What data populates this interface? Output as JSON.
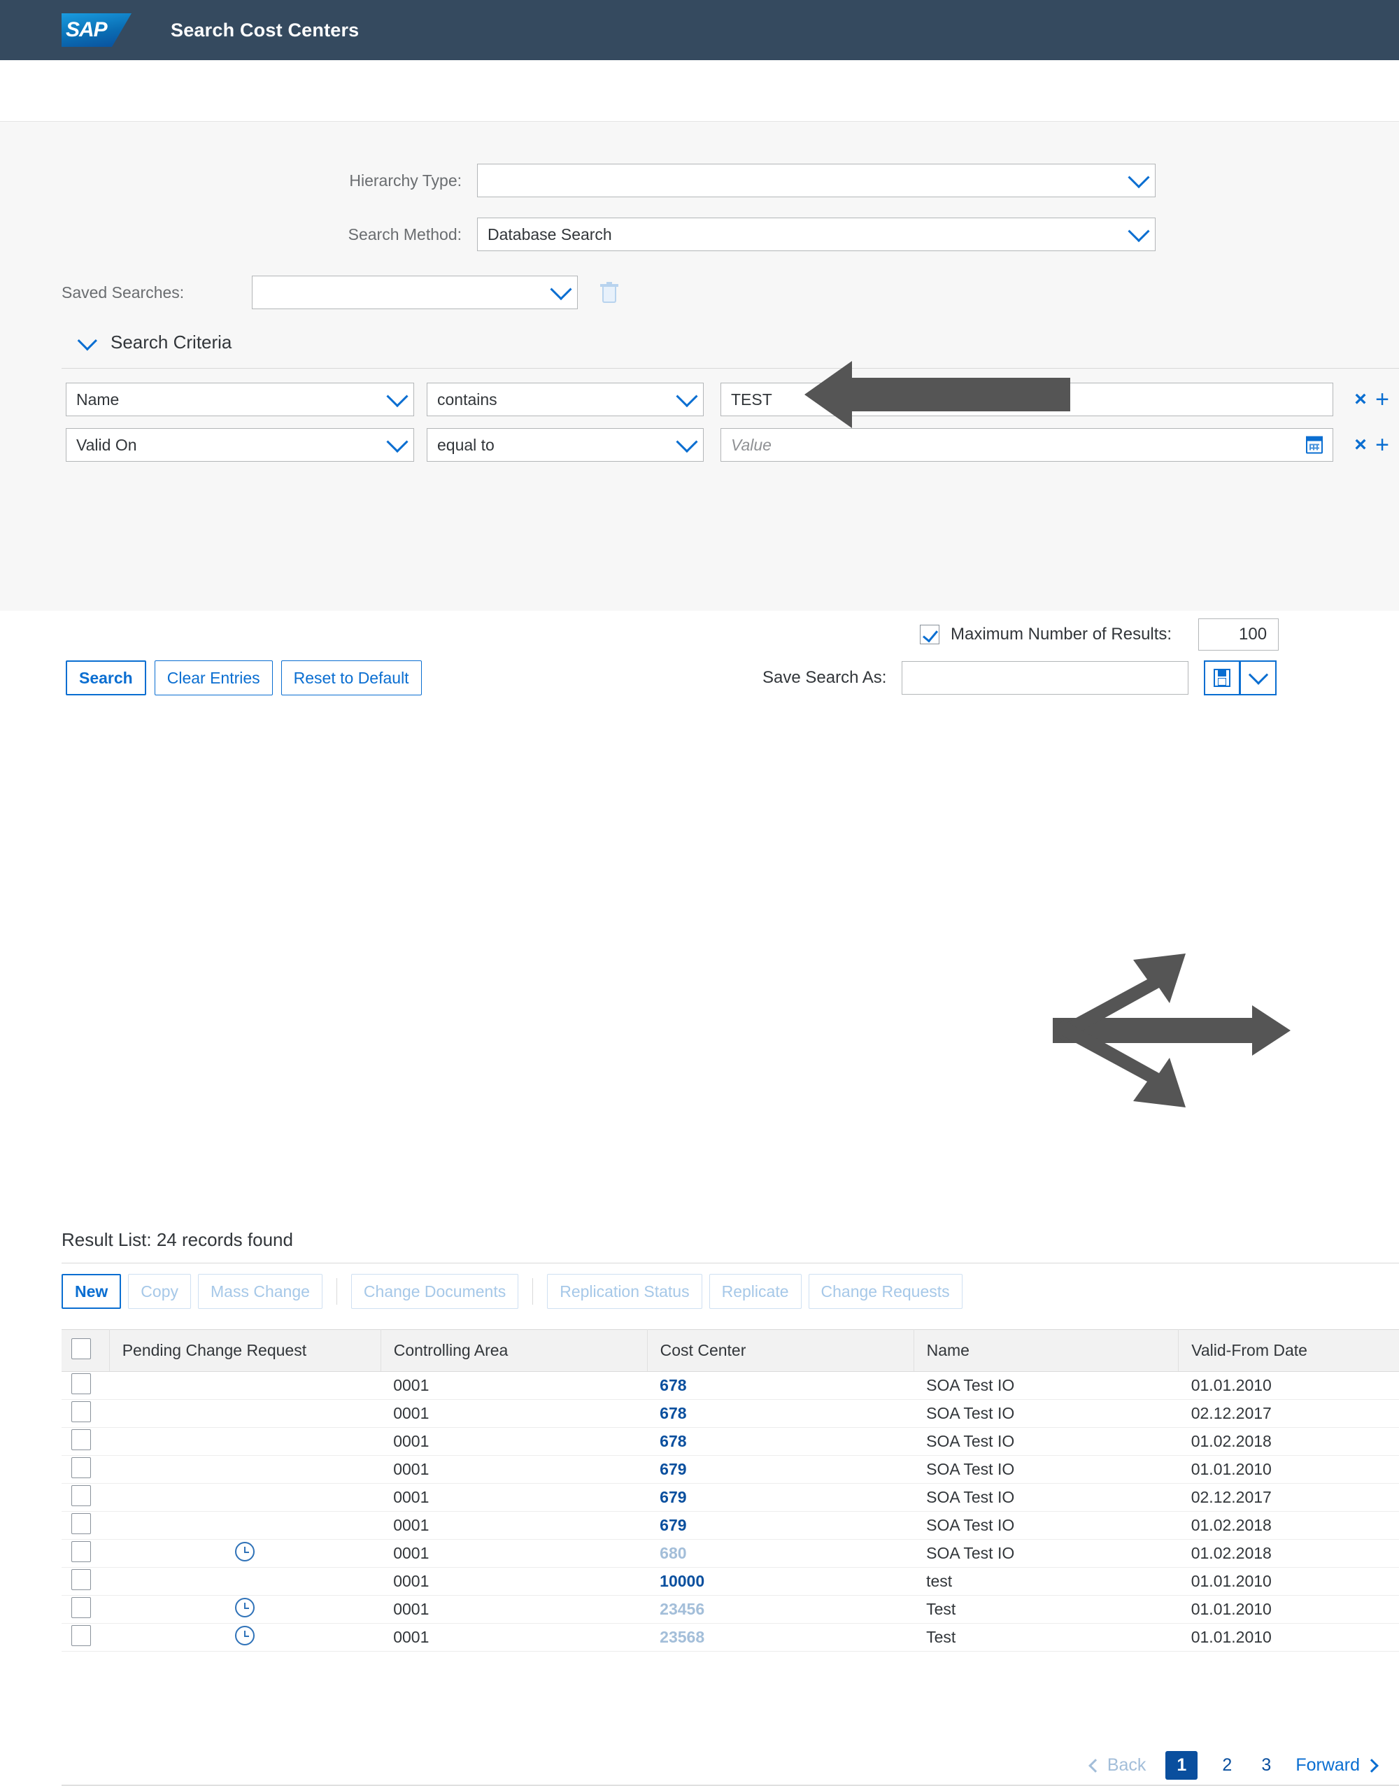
{
  "shell": {
    "logo_text": "SAP",
    "title": "Search Cost Centers"
  },
  "form": {
    "hierarchy_type_label": "Hierarchy Type:",
    "hierarchy_type_value": "",
    "search_method_label": "Search Method:",
    "search_method_value": "Database Search",
    "saved_searches_label": "Saved Searches:",
    "saved_searches_value": "",
    "delete_saved_search_tooltip": "Delete"
  },
  "criteria": {
    "section_title": "Search Criteria",
    "rows": [
      {
        "field": "Name",
        "operator": "contains",
        "value": "TEST",
        "placeholder": "Value",
        "has_date_picker": false
      },
      {
        "field": "Valid On",
        "operator": "equal to",
        "value": "",
        "placeholder": "Value",
        "has_date_picker": true
      }
    ],
    "remove_label": "×",
    "add_label": "+"
  },
  "max_results": {
    "label": "Maximum Number of Results:",
    "checked": true,
    "value": "100"
  },
  "actions": {
    "search": "Search",
    "clear_entries": "Clear Entries",
    "reset_to_default": "Reset to Default"
  },
  "save_search": {
    "label": "Save Search As:",
    "value": "",
    "save_icon": "floppy-disk-icon",
    "menu_icon": "chevron-down-icon"
  },
  "result_list": {
    "title": "Result List: 24 records found",
    "toolbar": [
      {
        "label": "New",
        "disabled": false,
        "emphasized": true
      },
      {
        "label": "Copy",
        "disabled": true,
        "emphasized": false
      },
      {
        "label": "Mass Change",
        "disabled": true,
        "emphasized": false
      },
      {
        "label": "Change Documents",
        "disabled": true,
        "emphasized": false
      },
      {
        "label": "Replication Status",
        "disabled": true,
        "emphasized": false
      },
      {
        "label": "Replicate",
        "disabled": true,
        "emphasized": false
      },
      {
        "label": "Change Requests",
        "disabled": true,
        "emphasized": false
      }
    ],
    "columns": [
      "Pending Change Request",
      "Controlling Area",
      "Cost Center",
      "Name",
      "Valid-From Date"
    ],
    "rows": [
      {
        "pending": false,
        "controlling_area": "0001",
        "cost_center": "678",
        "cc_muted": false,
        "name": "SOA Test IO",
        "valid_from": "01.01.2010"
      },
      {
        "pending": false,
        "controlling_area": "0001",
        "cost_center": "678",
        "cc_muted": false,
        "name": "SOA Test IO",
        "valid_from": "02.12.2017"
      },
      {
        "pending": false,
        "controlling_area": "0001",
        "cost_center": "678",
        "cc_muted": false,
        "name": "SOA Test IO",
        "valid_from": "01.02.2018"
      },
      {
        "pending": false,
        "controlling_area": "0001",
        "cost_center": "679",
        "cc_muted": false,
        "name": "SOA Test IO",
        "valid_from": "01.01.2010"
      },
      {
        "pending": false,
        "controlling_area": "0001",
        "cost_center": "679",
        "cc_muted": false,
        "name": "SOA Test IO",
        "valid_from": "02.12.2017"
      },
      {
        "pending": false,
        "controlling_area": "0001",
        "cost_center": "679",
        "cc_muted": false,
        "name": "SOA Test IO",
        "valid_from": "01.02.2018"
      },
      {
        "pending": true,
        "controlling_area": "0001",
        "cost_center": "680",
        "cc_muted": true,
        "name": "SOA Test IO",
        "valid_from": "01.02.2018"
      },
      {
        "pending": false,
        "controlling_area": "0001",
        "cost_center": "10000",
        "cc_muted": false,
        "name": "test",
        "valid_from": "01.01.2010"
      },
      {
        "pending": true,
        "controlling_area": "0001",
        "cost_center": "23456",
        "cc_muted": true,
        "name": "Test",
        "valid_from": "01.01.2010"
      },
      {
        "pending": true,
        "controlling_area": "0001",
        "cost_center": "23568",
        "cc_muted": true,
        "name": "Test",
        "valid_from": "01.01.2010"
      }
    ]
  },
  "pagination": {
    "back": "Back",
    "forward": "Forward",
    "pages": [
      "1",
      "2",
      "3"
    ],
    "current": "1"
  },
  "annotations": {
    "arrow_to_value_field": "arrow pointing left to the Name criteria value field",
    "arrow_to_row_test": "double arrow pointing at result rows"
  }
}
